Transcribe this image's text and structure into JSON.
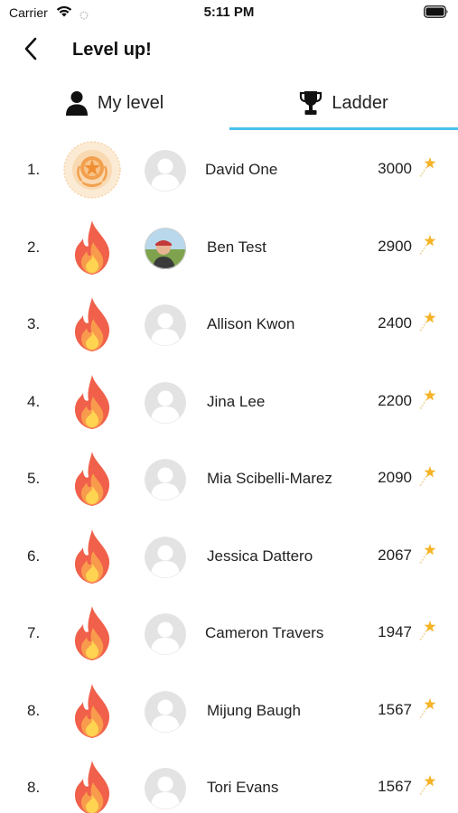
{
  "status_bar": {
    "carrier": "Carrier",
    "time": "5:11 PM"
  },
  "nav": {
    "title": "Level up!"
  },
  "tabs": [
    {
      "label": "My level",
      "icon": "person-icon",
      "selected": false
    },
    {
      "label": "Ladder",
      "icon": "trophy-icon",
      "selected": true
    }
  ],
  "colors": {
    "accent": "#49c1ec",
    "flame_outer": "#f0604a",
    "flame_inner": "#ffd451",
    "star": "#f5b325"
  },
  "ladder": [
    {
      "rank": "1.",
      "badge": "sun-medal-icon",
      "avatar": "default-avatar-icon",
      "name": "David One",
      "points": "3000"
    },
    {
      "rank": "2.",
      "badge": "flame-icon",
      "avatar": "user-photo",
      "name": "Ben Test",
      "points": "2900"
    },
    {
      "rank": "3.",
      "badge": "flame-icon",
      "avatar": "default-avatar-icon",
      "name": "Allison Kwon",
      "points": "2400"
    },
    {
      "rank": "4.",
      "badge": "flame-icon",
      "avatar": "default-avatar-icon",
      "name": "Jina Lee",
      "points": "2200"
    },
    {
      "rank": "5.",
      "badge": "flame-icon",
      "avatar": "default-avatar-icon",
      "name": "Mia Scibelli-Marez",
      "points": "2090"
    },
    {
      "rank": "6.",
      "badge": "flame-icon",
      "avatar": "default-avatar-icon",
      "name": "Jessica Dattero",
      "points": "2067"
    },
    {
      "rank": "7.",
      "badge": "flame-icon",
      "avatar": "default-avatar-icon",
      "name": "Cameron Travers",
      "points": "1947"
    },
    {
      "rank": "8.",
      "badge": "flame-icon",
      "avatar": "default-avatar-icon",
      "name": "Mijung Baugh",
      "points": "1567"
    },
    {
      "rank": "8.",
      "badge": "flame-icon",
      "avatar": "default-avatar-icon",
      "name": "Tori Evans",
      "points": "1567"
    }
  ]
}
